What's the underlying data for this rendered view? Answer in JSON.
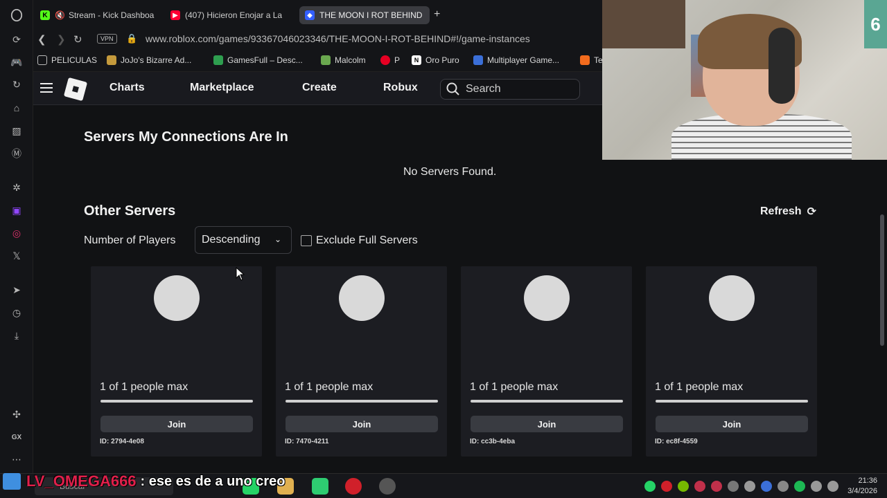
{
  "tabs": [
    {
      "title": "Stream - Kick Dashboa",
      "icon": "K",
      "icon_color": "#53fc18"
    },
    {
      "title": "(407) Hicieron Enojar a La",
      "icon": "▶",
      "icon_color": "#ff0033"
    },
    {
      "title": "THE MOON I ROT BEHIND",
      "icon": "◆",
      "icon_color": "#335fff"
    }
  ],
  "address": {
    "vpn": "VPN",
    "url": "www.roblox.com/games/93367046023346/THE-MOON-I-ROT-BEHIND#!/game-instances"
  },
  "bookmarks": [
    {
      "label": "PELICULAS"
    },
    {
      "label": "JoJo's Bizarre Ad..."
    },
    {
      "label": "GamesFull – Desc..."
    },
    {
      "label": "Malcolm"
    },
    {
      "label": "P"
    },
    {
      "label": "Oro Puro"
    },
    {
      "label": "Multiplayer Game..."
    },
    {
      "label": "Te"
    }
  ],
  "header": {
    "nav": [
      "Charts",
      "Marketplace",
      "Create",
      "Robux"
    ],
    "search_placeholder": "Search"
  },
  "connections": {
    "title": "Servers My Connections Are In",
    "empty": "No Servers Found."
  },
  "other": {
    "title": "Other Servers",
    "refresh": "Refresh",
    "filter_label": "Number of Players",
    "sort_value": "Descending",
    "exclude_label": "Exclude Full Servers"
  },
  "servers": [
    {
      "players": "1 of 1 people max",
      "join": "Join",
      "id": "ID: 2794-4e08",
      "fill": 1.0
    },
    {
      "players": "1 of 1 people max",
      "join": "Join",
      "id": "ID: 7470-4211",
      "fill": 1.0
    },
    {
      "players": "1 of 1 people max",
      "join": "Join",
      "id": "ID: cc3b-4eba",
      "fill": 1.0
    },
    {
      "players": "1 of 1 people max",
      "join": "Join",
      "id": "ID: ec8f-4559",
      "fill": 1.0
    }
  ],
  "overlay": {
    "chat_user": "LV_OMEGA666",
    "chat_message": ": ese es de a uno creo",
    "webcam_label": "6"
  },
  "taskbar": {
    "search": "Buscar",
    "time": "21:36",
    "date": "3/4/2026"
  }
}
